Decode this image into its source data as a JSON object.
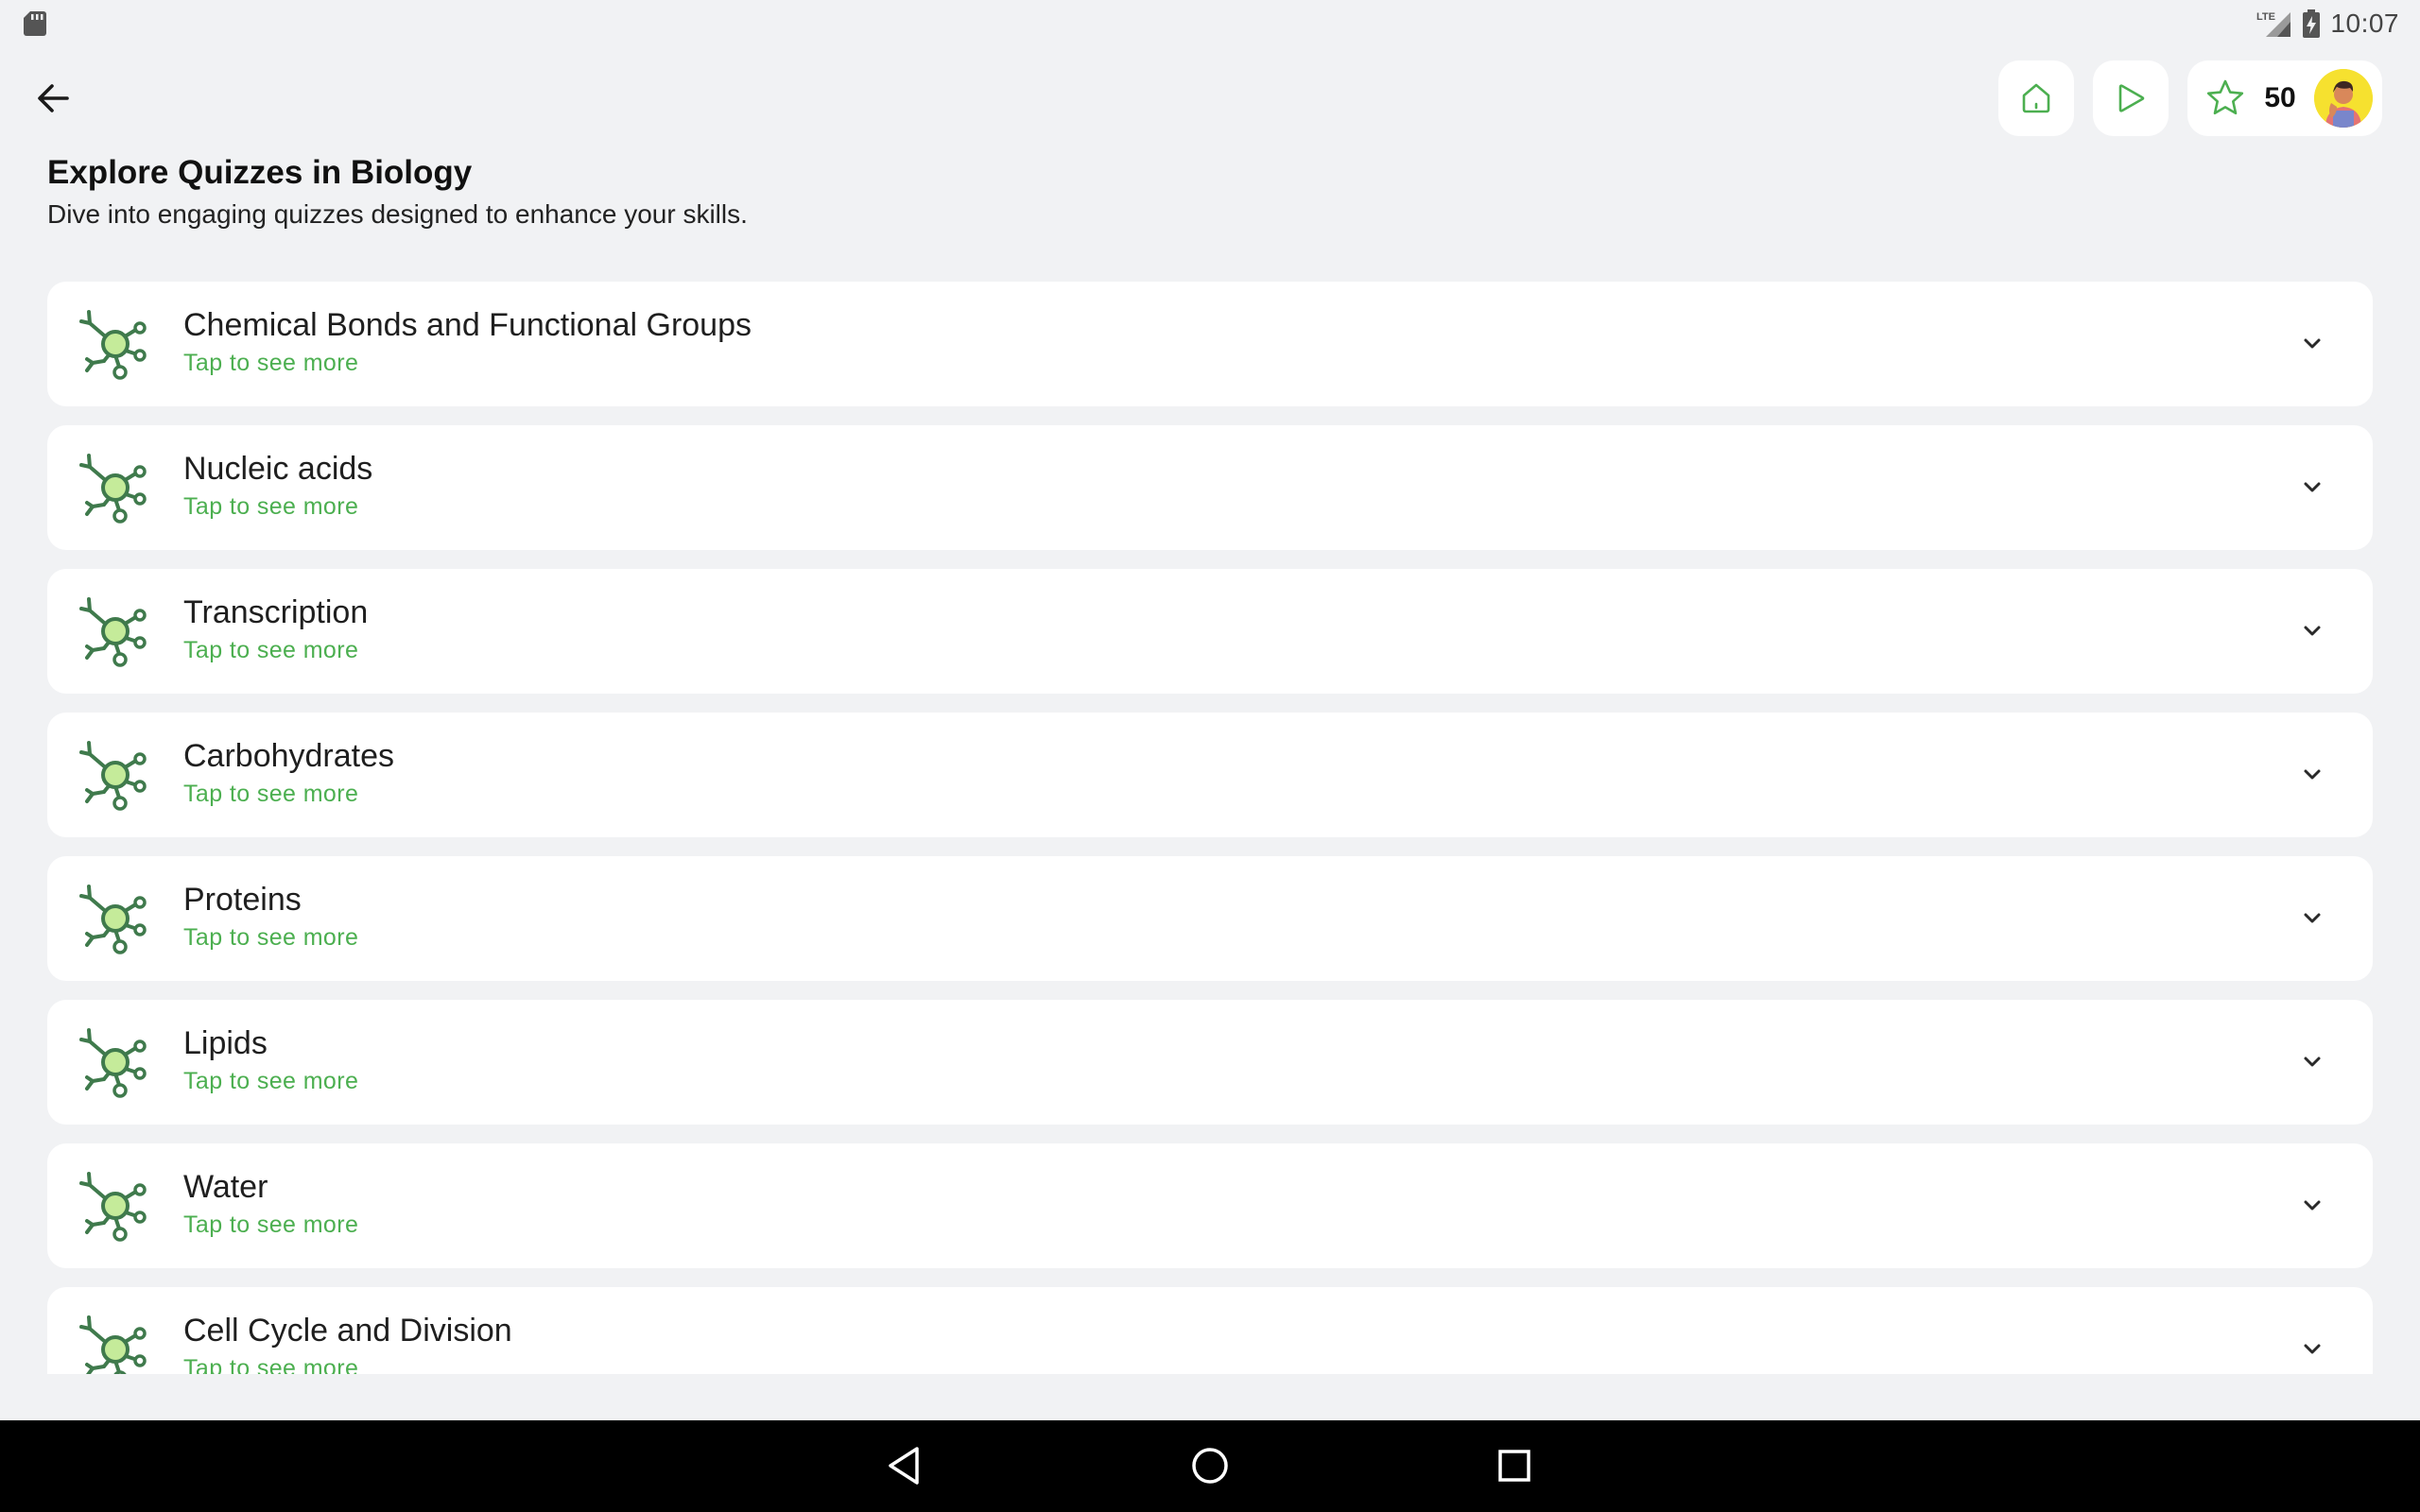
{
  "status_bar": {
    "time": "10:07",
    "icons": [
      "sd-card-icon",
      "lte-signal-icon",
      "battery-charging-icon"
    ]
  },
  "top_bar": {
    "back_icon": "arrow-left-icon",
    "home_icon": "home-icon",
    "play_icon": "play-icon",
    "star_icon": "star-icon",
    "points": "50"
  },
  "header": {
    "title": "Explore Quizzes in Biology",
    "subtitle": "Dive into engaging quizzes designed to enhance your skills."
  },
  "quizzes": [
    {
      "title": "Chemical Bonds and Functional Groups",
      "subtitle": "Tap to see more"
    },
    {
      "title": "Nucleic acids",
      "subtitle": "Tap to see more"
    },
    {
      "title": "Transcription",
      "subtitle": "Tap to see more"
    },
    {
      "title": "Carbohydrates",
      "subtitle": "Tap to see more"
    },
    {
      "title": "Proteins",
      "subtitle": "Tap to see more"
    },
    {
      "title": "Lipids",
      "subtitle": "Tap to see more"
    },
    {
      "title": "Water",
      "subtitle": "Tap to see more"
    },
    {
      "title": "Cell Cycle and Division",
      "subtitle": "Tap to see more"
    }
  ],
  "colors": {
    "accent_green": "#4caf50",
    "icon_dark_green": "#3f7a4c",
    "icon_light_green": "#c5eb9a",
    "avatar_bg": "#f6e12f",
    "background": "#f1f2f4"
  },
  "nav_bar": {
    "icons": [
      "nav-back-icon",
      "nav-home-icon",
      "nav-recents-icon"
    ]
  }
}
